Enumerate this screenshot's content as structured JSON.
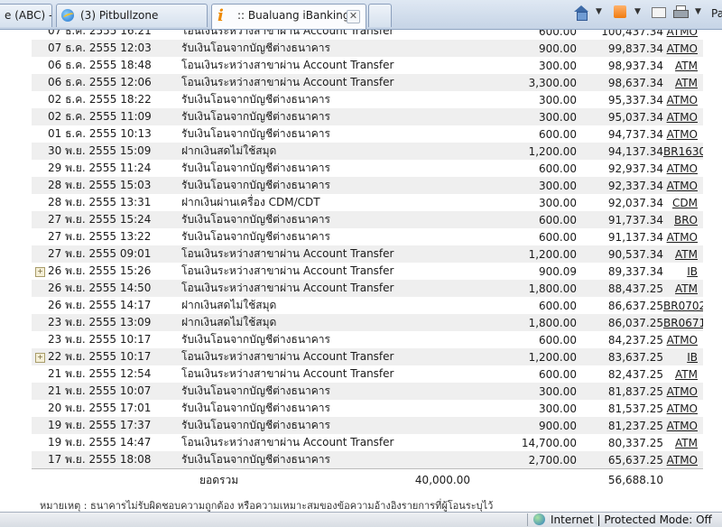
{
  "browser": {
    "tabs": [
      {
        "label": "e (ABC) - ..."
      },
      {
        "label": "(3) Pitbullzone"
      },
      {
        "label": ":: Bualuang iBanking ::"
      }
    ],
    "page_menu_label": "Pa",
    "status_zone": "Internet | Protected Mode: Off"
  },
  "transactions": [
    {
      "date": "07 ธ.ค. 2555 16:21",
      "desc": "โอนเงินระหว่างสาขาผ่าน Account Transfer",
      "amount": "600.00",
      "balance": "100,437.34",
      "channel": "ATMO"
    },
    {
      "date": "07 ธ.ค. 2555 12:03",
      "desc": "รับเงินโอนจากบัญชีต่างธนาคาร",
      "amount": "900.00",
      "balance": "99,837.34",
      "channel": "ATMO"
    },
    {
      "date": "06 ธ.ค. 2555 18:48",
      "desc": "โอนเงินระหว่างสาขาผ่าน Account Transfer",
      "amount": "300.00",
      "balance": "98,937.34",
      "channel": "ATM"
    },
    {
      "date": "06 ธ.ค. 2555 12:06",
      "desc": "โอนเงินระหว่างสาขาผ่าน Account Transfer",
      "amount": "3,300.00",
      "balance": "98,637.34",
      "channel": "ATM"
    },
    {
      "date": "02 ธ.ค. 2555 18:22",
      "desc": "รับเงินโอนจากบัญชีต่างธนาคาร",
      "amount": "300.00",
      "balance": "95,337.34",
      "channel": "ATMO"
    },
    {
      "date": "02 ธ.ค. 2555 11:09",
      "desc": "รับเงินโอนจากบัญชีต่างธนาคาร",
      "amount": "300.00",
      "balance": "95,037.34",
      "channel": "ATMO"
    },
    {
      "date": "01 ธ.ค. 2555 10:13",
      "desc": "รับเงินโอนจากบัญชีต่างธนาคาร",
      "amount": "600.00",
      "balance": "94,737.34",
      "channel": "ATMO"
    },
    {
      "date": "30 พ.ย. 2555 15:09",
      "desc": "ฝากเงินสดไม่ใช้สมุด",
      "amount": "1,200.00",
      "balance": "94,137.34",
      "channel": "BR1630"
    },
    {
      "date": "29 พ.ย. 2555 11:24",
      "desc": "รับเงินโอนจากบัญชีต่างธนาคาร",
      "amount": "600.00",
      "balance": "92,937.34",
      "channel": "ATMO"
    },
    {
      "date": "28 พ.ย. 2555 15:03",
      "desc": "รับเงินโอนจากบัญชีต่างธนาคาร",
      "amount": "300.00",
      "balance": "92,337.34",
      "channel": "ATMO"
    },
    {
      "date": "28 พ.ย. 2555 13:31",
      "desc": "ฝากเงินผ่านเครื่อง CDM/CDT",
      "amount": "300.00",
      "balance": "92,037.34",
      "channel": "CDM"
    },
    {
      "date": "27 พ.ย. 2555 15:24",
      "desc": "รับเงินโอนจากบัญชีต่างธนาคาร",
      "amount": "600.00",
      "balance": "91,737.34",
      "channel": "BRO"
    },
    {
      "date": "27 พ.ย. 2555 13:22",
      "desc": "รับเงินโอนจากบัญชีต่างธนาคาร",
      "amount": "600.00",
      "balance": "91,137.34",
      "channel": "ATMO"
    },
    {
      "date": "27 พ.ย. 2555 09:01",
      "desc": "โอนเงินระหว่างสาขาผ่าน Account Transfer",
      "amount": "1,200.00",
      "balance": "90,537.34",
      "channel": "ATM"
    },
    {
      "date": "26 พ.ย. 2555 15:26",
      "desc": "โอนเงินระหว่างสาขาผ่าน Account Transfer",
      "amount": "900.09",
      "balance": "89,337.34",
      "channel": "IB",
      "expandable": true
    },
    {
      "date": "26 พ.ย. 2555 14:50",
      "desc": "โอนเงินระหว่างสาขาผ่าน Account Transfer",
      "amount": "1,800.00",
      "balance": "88,437.25",
      "channel": "ATM"
    },
    {
      "date": "26 พ.ย. 2555 14:17",
      "desc": "ฝากเงินสดไม่ใช้สมุด",
      "amount": "600.00",
      "balance": "86,637.25",
      "channel": "BR0702"
    },
    {
      "date": "23 พ.ย. 2555 13:09",
      "desc": "ฝากเงินสดไม่ใช้สมุด",
      "amount": "1,800.00",
      "balance": "86,037.25",
      "channel": "BR0671"
    },
    {
      "date": "23 พ.ย. 2555 10:17",
      "desc": "รับเงินโอนจากบัญชีต่างธนาคาร",
      "amount": "600.00",
      "balance": "84,237.25",
      "channel": "ATMO"
    },
    {
      "date": "22 พ.ย. 2555 10:17",
      "desc": "โอนเงินระหว่างสาขาผ่าน Account Transfer",
      "amount": "1,200.00",
      "balance": "83,637.25",
      "channel": "IB",
      "expandable": true
    },
    {
      "date": "21 พ.ย. 2555 12:54",
      "desc": "โอนเงินระหว่างสาขาผ่าน Account Transfer",
      "amount": "600.00",
      "balance": "82,437.25",
      "channel": "ATM"
    },
    {
      "date": "21 พ.ย. 2555 10:07",
      "desc": "รับเงินโอนจากบัญชีต่างธนาคาร",
      "amount": "300.00",
      "balance": "81,837.25",
      "channel": "ATMO"
    },
    {
      "date": "20 พ.ย. 2555 17:01",
      "desc": "รับเงินโอนจากบัญชีต่างธนาคาร",
      "amount": "300.00",
      "balance": "81,537.25",
      "channel": "ATMO"
    },
    {
      "date": "19 พ.ย. 2555 17:37",
      "desc": "รับเงินโอนจากบัญชีต่างธนาคาร",
      "amount": "900.00",
      "balance": "81,237.25",
      "channel": "ATMO"
    },
    {
      "date": "19 พ.ย. 2555 14:47",
      "desc": "โอนเงินระหว่างสาขาผ่าน Account Transfer",
      "amount": "14,700.00",
      "balance": "80,337.25",
      "channel": "ATM"
    },
    {
      "date": "17 พ.ย. 2555 18:08",
      "desc": "รับเงินโอนจากบัญชีต่างธนาคาร",
      "amount": "2,700.00",
      "balance": "65,637.25",
      "channel": "ATMO"
    }
  ],
  "totals": {
    "label": "ยอดรวม",
    "debit": "40,000.00",
    "credit": "56,688.10"
  },
  "footnote": "หมายเหตุ : ธนาคารไม่รับผิดชอบความถูกต้อง หรือความเหมาะสมของข้อความอ้างอิงรายการที่ผู้โอนระบุไว้"
}
